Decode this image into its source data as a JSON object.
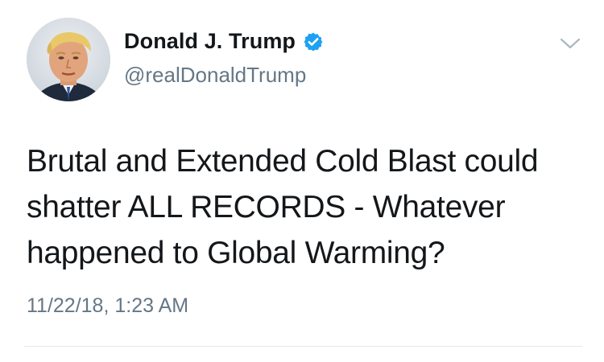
{
  "tweet": {
    "author": {
      "display_name": "Donald J. Trump",
      "handle": "@realDonaldTrump",
      "verified": true,
      "avatar_icon": "profile-photo"
    },
    "text": "Brutal and Extended Cold Blast could\nshatter ALL RECORDS - Whatever\nhappened to Global Warming?",
    "timestamp": "11/22/18, 1:23 AM",
    "menu_icon": "chevron-down-icon"
  },
  "colors": {
    "primary_text": "#14171a",
    "secondary_text": "#657786",
    "verified_blue": "#1da1f2",
    "divider": "#e1e8ed"
  }
}
